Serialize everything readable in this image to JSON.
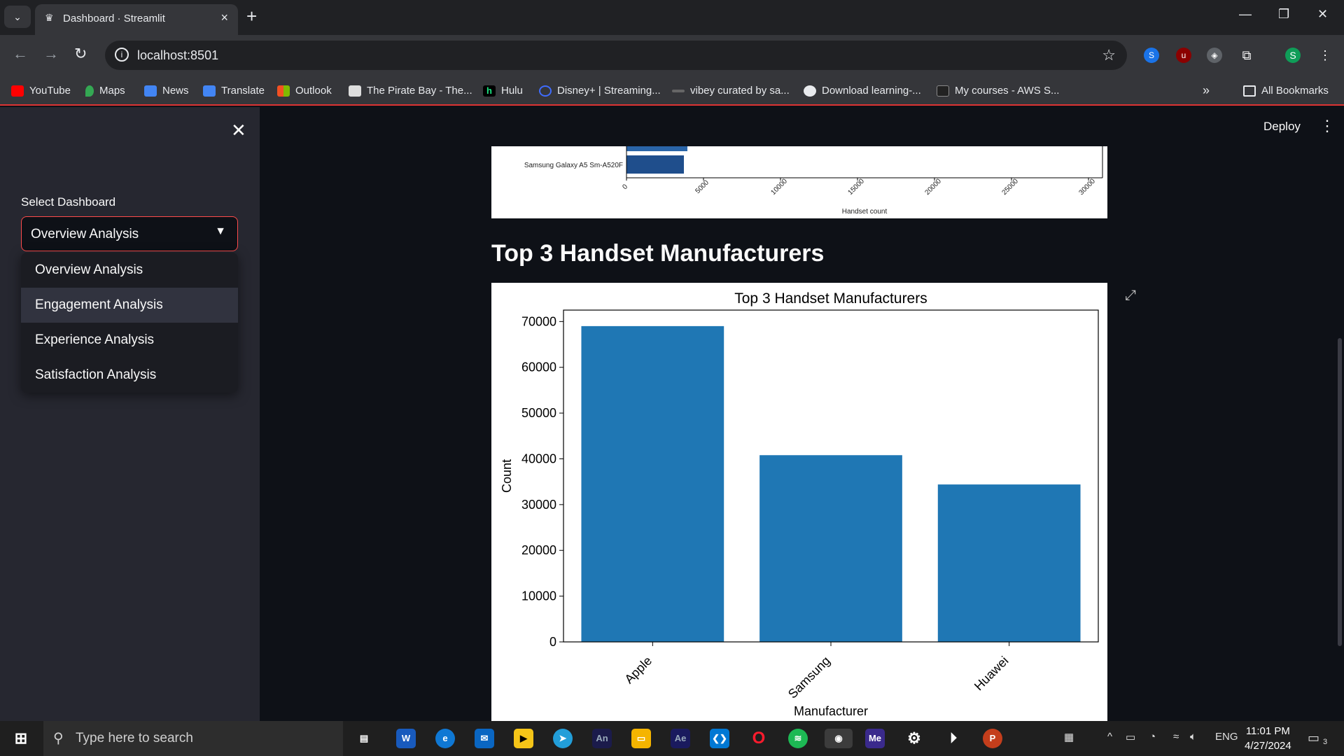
{
  "browser": {
    "tab_title": "Dashboard · Streamlit",
    "url": "localhost:8501",
    "bookmarks": [
      "YouTube",
      "Maps",
      "News",
      "Translate",
      "Outlook",
      "The Pirate Bay - The...",
      "Hulu",
      "Disney+ | Streaming...",
      "vibey curated by sa...",
      "Download learning-...",
      "My courses - AWS S..."
    ],
    "all_bookmarks": "All Bookmarks",
    "profile_initial": "S"
  },
  "sidebar": {
    "label": "Select Dashboard",
    "selected": "Overview Analysis",
    "options": [
      "Overview Analysis",
      "Engagement Analysis",
      "Experience Analysis",
      "Satisfaction Analysis"
    ]
  },
  "header": {
    "deploy": "Deploy"
  },
  "prev_chart": {
    "visible_category": "Samsung Galaxy A5 Sm-A520F",
    "visible_value": 3800,
    "xticks": [
      "0",
      "5000",
      "10000",
      "15000",
      "20000",
      "25000",
      "30000"
    ],
    "xlabel": "Handset count"
  },
  "section_title": "Top 3 Handset Manufacturers",
  "chart_data": {
    "type": "bar",
    "title": "Top 3 Handset Manufacturers",
    "categories": [
      "Apple",
      "Samsung",
      "Huawei"
    ],
    "values": [
      69000,
      40800,
      34400
    ],
    "xlabel": "Manufacturer",
    "ylabel": "Count",
    "ylim": [
      0,
      72500
    ],
    "yticks": [
      0,
      10000,
      20000,
      30000,
      40000,
      50000,
      60000,
      70000
    ],
    "color": "#1f77b4"
  },
  "taskbar": {
    "search_placeholder": "Type here to search",
    "lang": "ENG",
    "time": "11:01 PM",
    "date": "4/27/2024",
    "notif_count": "3"
  },
  "colors": {
    "accent": "#ff4b4b",
    "bar": "#1f77b4",
    "sidebar_bg": "#262730",
    "main_bg": "#0e1117"
  }
}
